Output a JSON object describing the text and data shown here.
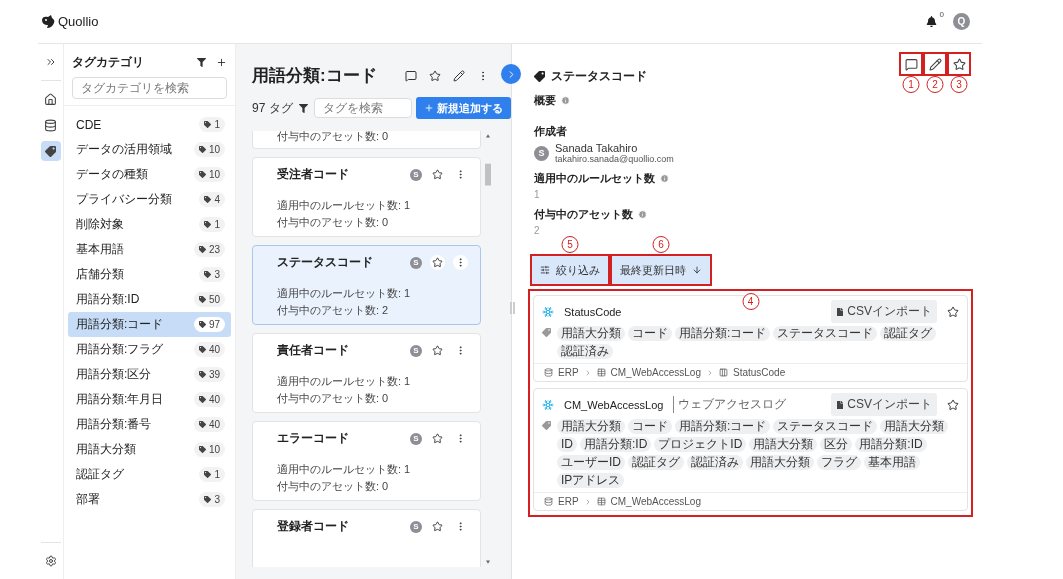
{
  "app": {
    "brand": "Quollio",
    "notifications": "0",
    "avatar": "Q"
  },
  "rail": {
    "items": [
      {
        "kind": "home",
        "selected": false
      },
      {
        "kind": "database",
        "selected": false
      },
      {
        "kind": "tag",
        "selected": true
      }
    ]
  },
  "categories": {
    "title": "タグカテゴリ",
    "search": {
      "placeholder": "タグカテゴリを検索"
    },
    "items": [
      {
        "name": "CDE",
        "count": "1",
        "selected": false
      },
      {
        "name": "データの活用領域",
        "count": "10",
        "selected": false
      },
      {
        "name": "データの種類",
        "count": "10",
        "selected": false
      },
      {
        "name": "プライバシー分類",
        "count": "4",
        "selected": false
      },
      {
        "name": "削除対象",
        "count": "1",
        "selected": false
      },
      {
        "name": "基本用語",
        "count": "23",
        "selected": false
      },
      {
        "name": "店舗分類",
        "count": "3",
        "selected": false
      },
      {
        "name": "用語分類:ID",
        "count": "50",
        "selected": false
      },
      {
        "name": "用語分類:コード",
        "count": "97",
        "selected": true
      },
      {
        "name": "用語分類:フラグ",
        "count": "40",
        "selected": false
      },
      {
        "name": "用語分類:区分",
        "count": "39",
        "selected": false
      },
      {
        "name": "用語分類:年月日",
        "count": "40",
        "selected": false
      },
      {
        "name": "用語分類:番号",
        "count": "40",
        "selected": false
      },
      {
        "name": "用語大分類",
        "count": "10",
        "selected": false
      },
      {
        "name": "認証タグ",
        "count": "1",
        "selected": false
      },
      {
        "name": "部署",
        "count": "3",
        "selected": false
      }
    ]
  },
  "tag_list": {
    "title": "用語分類:コード",
    "count": "97 タグ",
    "search": {
      "placeholder": "タグを検索"
    },
    "add_button": "新規追加する",
    "partial_card": {
      "assets": "付与中のアセット数: 0"
    },
    "cards": [
      {
        "name": "受注者コード",
        "avatar": "S",
        "rulesets": "適用中のルールセット数: 1",
        "assets": "付与中のアセット数: 0",
        "selected": false
      },
      {
        "name": "ステータスコード",
        "avatar": "S",
        "rulesets": "適用中のルールセット数: 1",
        "assets": "付与中のアセット数: 2",
        "selected": true
      },
      {
        "name": "責任者コード",
        "avatar": "S",
        "rulesets": "適用中のルールセット数: 1",
        "assets": "付与中のアセット数: 0",
        "selected": false
      },
      {
        "name": "エラーコード",
        "avatar": "S",
        "rulesets": "適用中のルールセット数: 1",
        "assets": "付与中のアセット数: 0",
        "selected": false
      },
      {
        "name": "登録者コード",
        "avatar": "S",
        "selected": false
      }
    ]
  },
  "detail": {
    "actions": [
      {
        "kind": "comment",
        "callout": "1"
      },
      {
        "kind": "edit",
        "callout": "2"
      },
      {
        "kind": "star",
        "callout": "3"
      }
    ],
    "title": "ステータスコード",
    "sections": [
      {
        "kind": "info",
        "label": "概要"
      },
      {
        "kind": "user",
        "label": "作成者",
        "avatar": "S",
        "user_name": "Sanada Takahiro",
        "email": "takahiro.sanada@quollio.com"
      },
      {
        "kind": "value",
        "label": "適用中のルールセット数",
        "value": "1"
      },
      {
        "kind": "value",
        "label": "付与中のアセット数",
        "value": "2"
      }
    ],
    "filter": {
      "label": "絞り込み",
      "callout": "5"
    },
    "sort": {
      "label": "最終更新日時",
      "callout": "6"
    },
    "results": {
      "callout": "4",
      "assets": [
        {
          "name": "StatusCode",
          "import": "CSVインポート",
          "tags": [
            "用語大分類",
            "コード",
            "用語分類:コード",
            "ステータスコード",
            "認証タグ",
            "認証済み"
          ],
          "path": [
            {
              "kind": "database",
              "label": "ERP"
            },
            {
              "kind": "table",
              "label": "CM_WebAccessLog"
            },
            {
              "kind": "column",
              "label": "StatusCode"
            }
          ]
        },
        {
          "name": "CM_WebAccessLog",
          "subtitle": "ウェブアクセスログ",
          "import": "CSVインポート",
          "tags": [
            "用語大分類",
            "コード",
            "用語分類:コード",
            "ステータスコード",
            "用語大分類",
            "ID",
            "用語分類:ID",
            "プロジェクトID",
            "用語大分類",
            "区分",
            "用語分類:ID",
            "ユーザーID",
            "認証タグ",
            "認証済み",
            "用語大分類",
            "フラグ",
            "基本用語",
            "IPアドレス"
          ],
          "path": [
            {
              "kind": "database",
              "label": "ERP"
            },
            {
              "kind": "table",
              "label": "CM_WebAccessLog"
            }
          ]
        }
      ]
    }
  }
}
